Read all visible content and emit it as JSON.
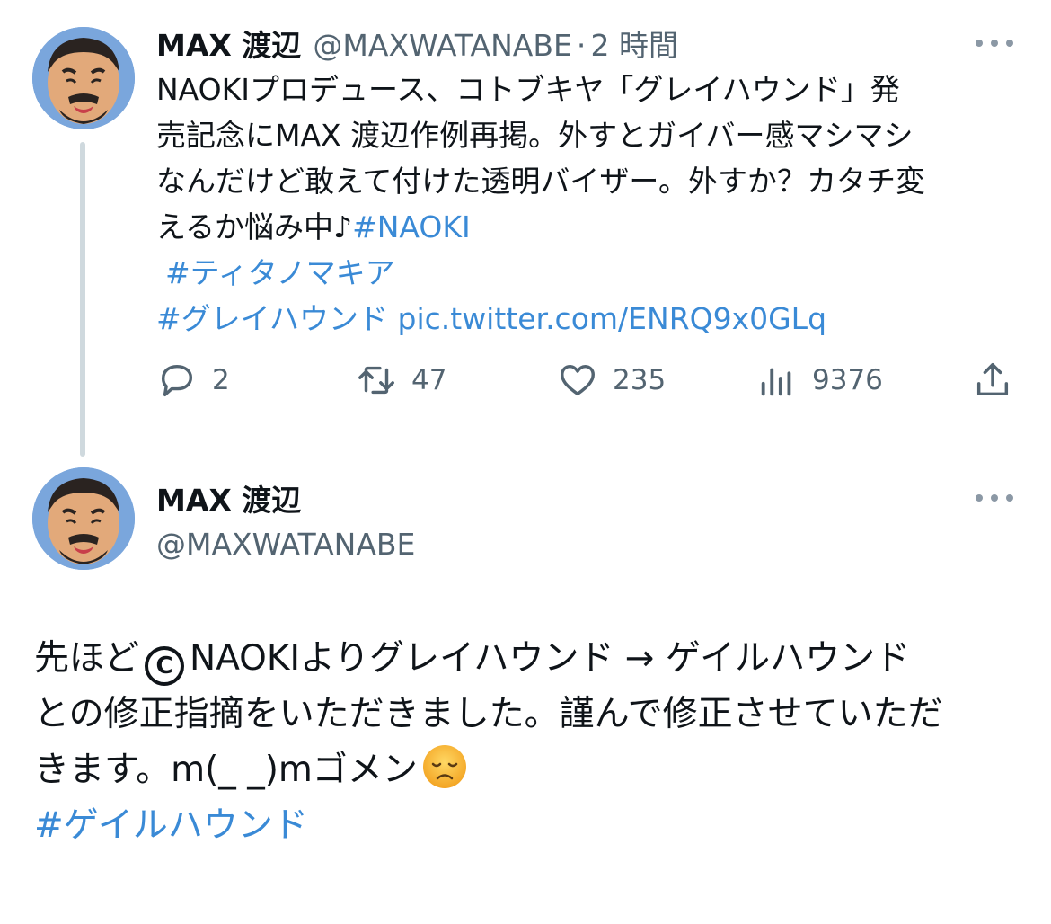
{
  "tweet1": {
    "name": "MAX 渡辺",
    "handle": "@MAXWATANABE",
    "separator": "·",
    "time": "2 時間",
    "text_lines": [
      "NAOKIプロデュース、コトブキヤ「グレイハウンド」発",
      "売記念にMAX 渡辺作例再掲。外すとガイバー感マシマシ",
      "なんだけど敢えて付けた透明バイザー。外すか？カタチ変",
      "えるか悩み中♪"
    ],
    "hashtag_inline": "#NAOKI",
    "hashtag2": "#ティタノマキア",
    "hashtag3": "#グレイハウンド",
    "pic_link": "pic.twitter.com/ENRQ9x0GLq",
    "actions": {
      "reply_count": "2",
      "retweet_count": "47",
      "like_count": "235",
      "view_count": "9376"
    },
    "icons": [
      "reply-icon",
      "retweet-icon",
      "heart-icon",
      "views-icon",
      "share-icon",
      "more-icon"
    ]
  },
  "tweet2": {
    "name": "MAX 渡辺",
    "handle": "@MAXWATANABE",
    "line1_a": "先ほど",
    "copyright_symbol": "C",
    "line1_b": "NAOKIよりグレイハウンド → ゲイルハウンド",
    "line2": "との修正指摘をいただきました。謹んで修正させていただ",
    "line3": "きます。m(_ _)mゴメン",
    "emoji": "disappointed-face-emoji",
    "hashtag": "#ゲイルハウンド"
  },
  "colors": {
    "link": "#3a8ad6",
    "secondary_text": "#536471",
    "thread_line": "#cfd9de"
  }
}
